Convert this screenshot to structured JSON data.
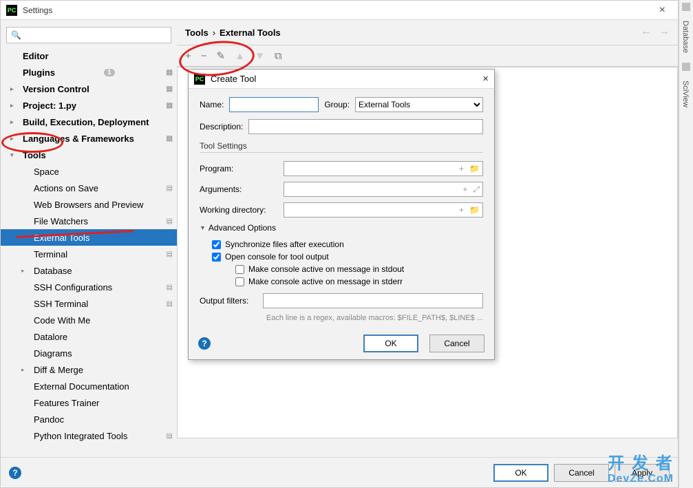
{
  "window": {
    "title": "Settings",
    "close": "×",
    "app_icon_text": "PC"
  },
  "search": {
    "placeholder": ""
  },
  "sidebar": {
    "items": [
      {
        "label": "Editor",
        "bold": true
      },
      {
        "label": "Plugins",
        "bold": true,
        "badge": "1",
        "gear": true
      },
      {
        "label": "Version Control",
        "bold": true,
        "chev": ">",
        "gear": true
      },
      {
        "label": "Project: 1.py",
        "bold": true,
        "chev": ">",
        "gear": true
      },
      {
        "label": "Build, Execution, Deployment",
        "bold": true,
        "chev": ">"
      },
      {
        "label": "Languages & Frameworks",
        "bold": true,
        "chev": ">",
        "gear": true
      },
      {
        "label": "Tools",
        "bold": true,
        "chev": "v"
      },
      {
        "label": "Space",
        "lvl": 2
      },
      {
        "label": "Actions on Save",
        "lvl": 2,
        "gear": true
      },
      {
        "label": "Web Browsers and Preview",
        "lvl": 2
      },
      {
        "label": "File Watchers",
        "lvl": 2,
        "gear": true
      },
      {
        "label": "External Tools",
        "lvl": 2,
        "selected": true
      },
      {
        "label": "Terminal",
        "lvl": 2,
        "gear": true
      },
      {
        "label": "Database",
        "lvl": 2,
        "chev": ">"
      },
      {
        "label": "SSH Configurations",
        "lvl": 2,
        "gear": true
      },
      {
        "label": "SSH Terminal",
        "lvl": 2,
        "gear": true
      },
      {
        "label": "Code With Me",
        "lvl": 2
      },
      {
        "label": "Datalore",
        "lvl": 2
      },
      {
        "label": "Diagrams",
        "lvl": 2
      },
      {
        "label": "Diff & Merge",
        "lvl": 2,
        "chev": ">"
      },
      {
        "label": "External Documentation",
        "lvl": 2
      },
      {
        "label": "Features Trainer",
        "lvl": 2
      },
      {
        "label": "Pandoc",
        "lvl": 2
      },
      {
        "label": "Python Integrated Tools",
        "lvl": 2,
        "gear": true
      }
    ]
  },
  "breadcrumb": {
    "root": "Tools",
    "sep": "›",
    "leaf": "External Tools"
  },
  "toolbar": {
    "add": "+",
    "remove": "−",
    "edit": "✎",
    "up": "▲",
    "down": "▼",
    "copy": "⧉"
  },
  "footer": {
    "help": "?",
    "ok": "OK",
    "cancel": "Cancel",
    "apply": "Apply"
  },
  "dialog": {
    "title": "Create Tool",
    "close": "×",
    "name_label": "Name:",
    "group_label": "Group:",
    "group_value": "External Tools",
    "desc_label": "Description:",
    "tool_settings": "Tool Settings",
    "program_label": "Program:",
    "args_label": "Arguments:",
    "wdir_label": "Working directory:",
    "adv_title": "Advanced Options",
    "sync_label": "Synchronize files after execution",
    "console_label": "Open console for tool output",
    "stdout_label": "Make console active on message in stdout",
    "stderr_label": "Make console active on message in stderr",
    "filters_label": "Output filters:",
    "hint": "Each line is a regex, available macros: $FILE_PATH$, $LINE$ ...",
    "help": "?",
    "ok": "OK",
    "cancel": "Cancel"
  },
  "rail": {
    "db": "Database",
    "sci": "SciView"
  },
  "watermark": {
    "cn": "开 发 者",
    "en": "DevZe.CoM"
  }
}
